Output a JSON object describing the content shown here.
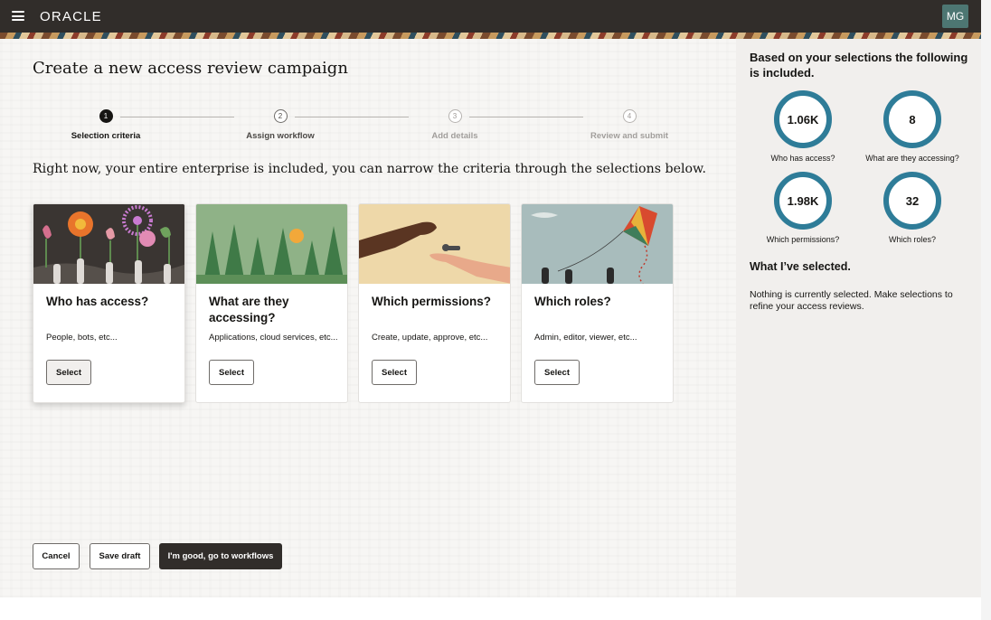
{
  "header": {
    "brand": "ORACLE",
    "avatar_initials": "MG"
  },
  "page": {
    "title": "Create a new access review campaign",
    "instructions": "Right now, your entire enterprise is included, you can narrow the criteria through the selections below."
  },
  "stepper": {
    "steps": [
      {
        "number": "1",
        "label": "Selection criteria",
        "state": "active"
      },
      {
        "number": "2",
        "label": "Assign workflow",
        "state": "enabled"
      },
      {
        "number": "3",
        "label": "Add details",
        "state": "disabled"
      },
      {
        "number": "4",
        "label": "Review and submit",
        "state": "disabled"
      }
    ]
  },
  "cards": [
    {
      "title": "Who has access?",
      "description": "People, bots, etc...",
      "button": "Select",
      "selected": true
    },
    {
      "title": "What are they accessing?",
      "description": "Applications, cloud services, etc...",
      "button": "Select",
      "selected": false
    },
    {
      "title": "Which permissions?",
      "description": "Create, update, approve, etc...",
      "button": "Select",
      "selected": false
    },
    {
      "title": "Which roles?",
      "description": "Admin, editor, viewer, etc...",
      "button": "Select",
      "selected": false
    }
  ],
  "footer": {
    "cancel": "Cancel",
    "save_draft": "Save draft",
    "next": "I'm good, go to workflows"
  },
  "summary": {
    "heading": "Based on your selections the following is included.",
    "metrics": [
      {
        "value": "1.06K",
        "label": "Who has access?"
      },
      {
        "value": "8",
        "label": "What are they accessing?"
      },
      {
        "value": "1.98K",
        "label": "Which permissions?"
      },
      {
        "value": "32",
        "label": "Which roles?"
      }
    ],
    "selected_heading": "What I’ve selected.",
    "selected_text": "Nothing is currently selected. Make selections to refine your access reviews."
  },
  "colors": {
    "header_bg": "#312d2a",
    "ring": "#2e7c98",
    "avatar_bg": "#4d7672",
    "primary_button": "#312d2a"
  }
}
